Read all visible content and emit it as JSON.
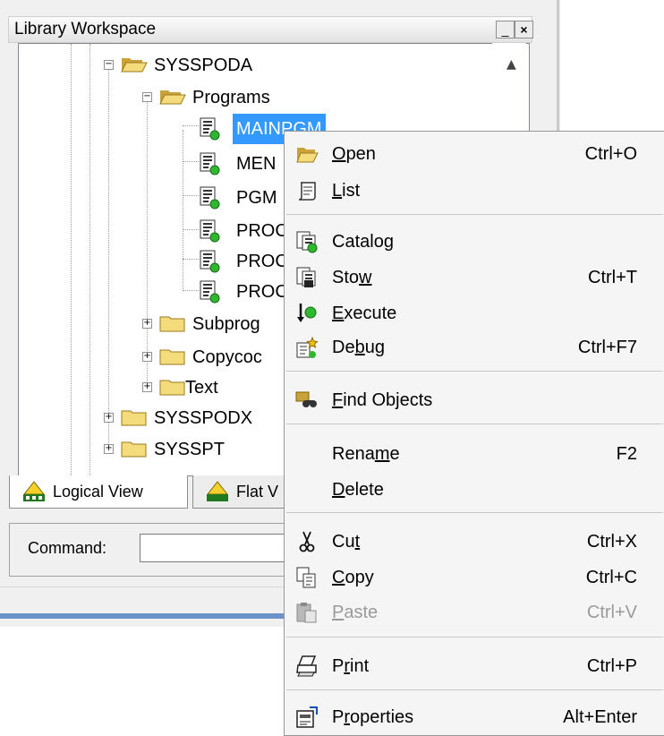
{
  "window": {
    "title": "Library Workspace",
    "minimize_glyph": "_",
    "close_glyph": "×",
    "scroll_up_glyph": "▲"
  },
  "tree": {
    "expand_glyph": "+",
    "collapse_glyph": "−",
    "nodes": [
      {
        "label": "SYSSPODA",
        "icon": "open-folder-icon"
      },
      {
        "label": "Programs",
        "icon": "open-folder-icon"
      },
      {
        "label": "MAINPGM",
        "icon": "program-icon",
        "selected": true
      },
      {
        "label": "MEN",
        "icon": "program-icon"
      },
      {
        "label": "PGM",
        "icon": "program-icon"
      },
      {
        "label": "PROC",
        "icon": "program-icon"
      },
      {
        "label": "PROC",
        "icon": "program-icon"
      },
      {
        "label": "PROC",
        "icon": "program-icon"
      },
      {
        "label": "Subprog",
        "icon": "folder-icon"
      },
      {
        "label": "Copycoc",
        "icon": "folder-icon"
      },
      {
        "label": "Text",
        "icon": "folder-icon"
      },
      {
        "label": "SYSSPODX",
        "icon": "folder-icon"
      },
      {
        "label": "SYSSPT",
        "icon": "folder-icon"
      }
    ]
  },
  "tabs": [
    {
      "label": "Logical View",
      "icon": "logical-view-icon"
    },
    {
      "label": "Flat V",
      "icon": "flat-view-icon"
    }
  ],
  "command": {
    "label": "Command:",
    "value": ""
  },
  "context_menu": {
    "items": [
      {
        "pre": "",
        "u": "O",
        "post": "pen",
        "shortcut": "Ctrl+O",
        "icon": "open-folder-icon"
      },
      {
        "pre": "",
        "u": "L",
        "post": "ist",
        "shortcut": "",
        "icon": "list-scroll-icon"
      },
      {
        "pre": "Catalo",
        "u": "g",
        "post": "",
        "shortcut": "",
        "icon": "catalog-icon"
      },
      {
        "pre": "Sto",
        "u": "w",
        "post": "",
        "shortcut": "Ctrl+T",
        "icon": "stow-icon"
      },
      {
        "pre": "",
        "u": "E",
        "post": "xecute",
        "shortcut": "",
        "icon": "execute-icon"
      },
      {
        "pre": "De",
        "u": "b",
        "post": "ug",
        "shortcut": "Ctrl+F7",
        "icon": "debug-icon"
      },
      {
        "pre": "",
        "u": "F",
        "post": "ind Objects",
        "shortcut": "",
        "icon": "find-objects-icon"
      },
      {
        "pre": "Rena",
        "u": "m",
        "post": "e",
        "shortcut": "F2",
        "icon": ""
      },
      {
        "pre": "",
        "u": "D",
        "post": "elete",
        "shortcut": "",
        "icon": ""
      },
      {
        "pre": "Cu",
        "u": "t",
        "post": "",
        "shortcut": "Ctrl+X",
        "icon": "scissors-icon"
      },
      {
        "pre": "",
        "u": "C",
        "post": "opy",
        "shortcut": "Ctrl+C",
        "icon": "copy-icon"
      },
      {
        "pre": "",
        "u": "P",
        "post": "aste",
        "shortcut": "Ctrl+V",
        "icon": "paste-icon",
        "disabled": true
      },
      {
        "pre": "P",
        "u": "r",
        "post": "int",
        "shortcut": "Ctrl+P",
        "icon": "print-icon"
      },
      {
        "pre": "P",
        "u": "r",
        "post": "operties",
        "shortcut": "Alt+Enter",
        "icon": "properties-icon"
      }
    ]
  }
}
